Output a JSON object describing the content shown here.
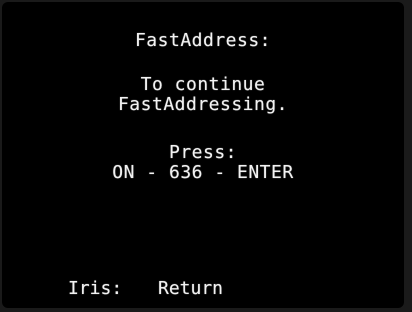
{
  "screen": {
    "title": "FastAddress:",
    "message_line1": "To continue",
    "message_line2": "FastAddressing.",
    "press_label": "Press:",
    "key_sequence": "ON - 636 - ENTER"
  },
  "footer": {
    "iris_key": "Iris:",
    "iris_action": "Return"
  },
  "colors": {
    "background": "#000000",
    "text": "#f2f2f2"
  }
}
